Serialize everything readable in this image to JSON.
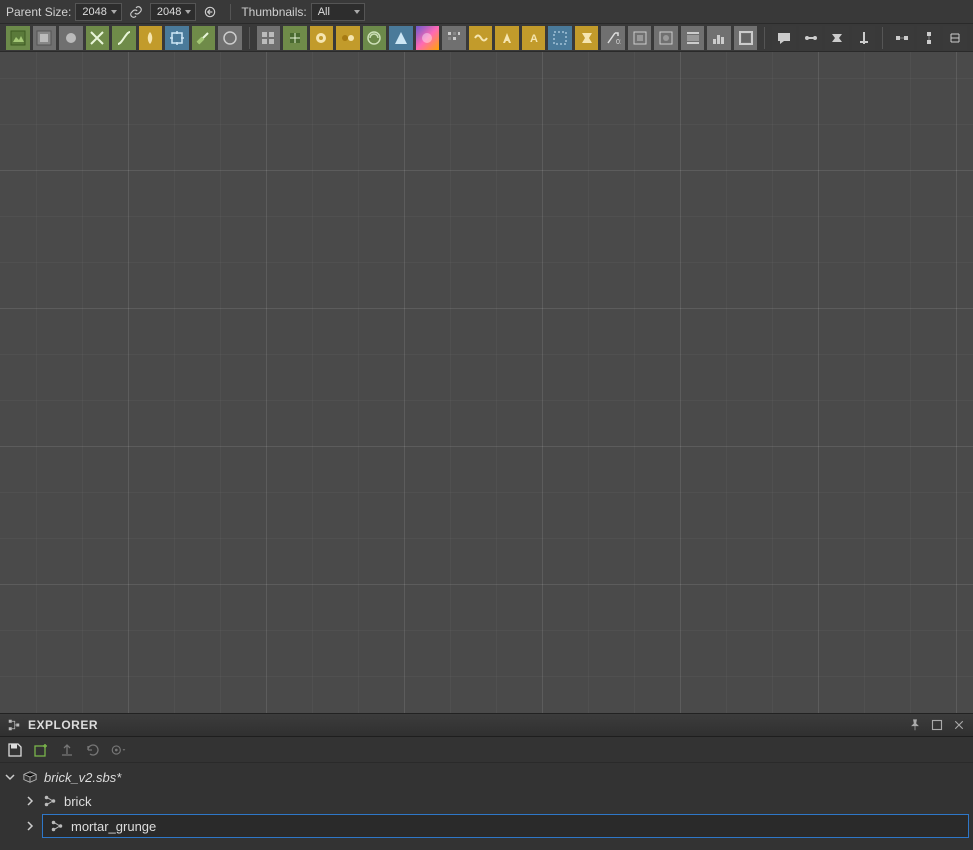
{
  "toolbar": {
    "parent_size_label": "Parent Size:",
    "parent_width": "2048",
    "parent_height": "2048",
    "thumbnails_label": "Thumbnails:",
    "thumbnails_value": "All"
  },
  "node_palette": {
    "items": [
      "bitmap",
      "svg",
      "uniform-color",
      "blend",
      "curve",
      "gradient-map",
      "transform-2d",
      "sharpen",
      "blur",
      "pixel-processor",
      "channel-shuffle",
      "fx-map",
      "levels",
      "dir-warp",
      "normal",
      "grayscale-conv",
      "hsl",
      "warp",
      "text",
      "svg-shape",
      "dyn-gradient",
      "tile-sampler",
      "splatter",
      "shape",
      "distance",
      "safe-transform",
      "histogram",
      "pixel-proc-2",
      "material-transform",
      "crop"
    ]
  },
  "graph_tools": {
    "items": [
      "comment",
      "frame",
      "snap",
      "align",
      "connect-horizontal",
      "connect-vertical",
      "arrange"
    ]
  },
  "explorer": {
    "title": "EXPLORER",
    "package": "brick_v2.sbs*",
    "graphs": [
      {
        "name": "brick"
      },
      {
        "name": "mortar_grunge"
      }
    ],
    "selected_index": 1
  }
}
